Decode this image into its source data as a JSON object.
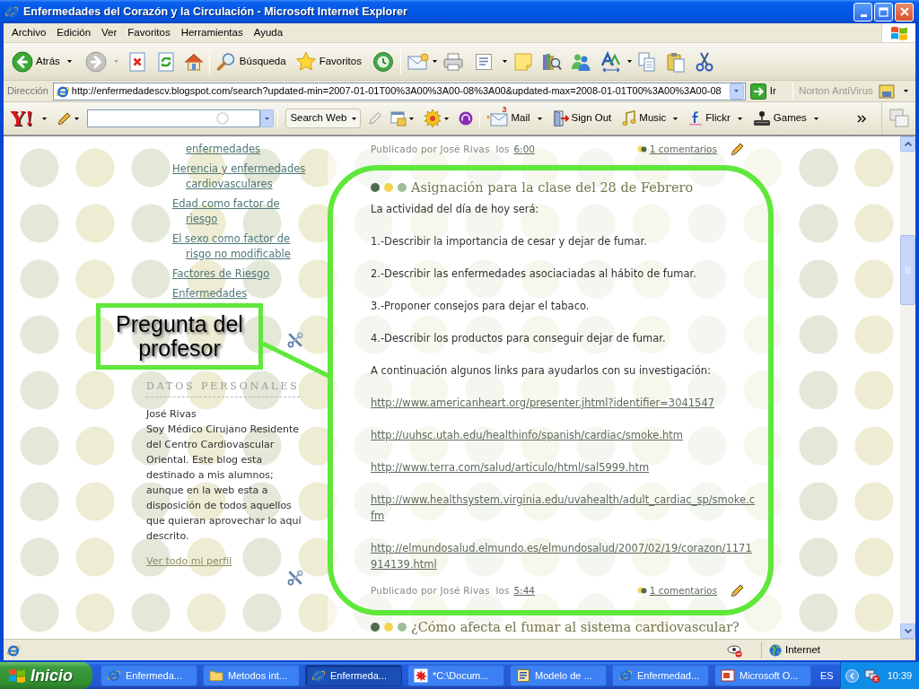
{
  "window": {
    "title": "Enfermedades del Corazón y la Circulación - Microsoft Internet Explorer"
  },
  "menu_bar": {
    "items": [
      "Archivo",
      "Edición",
      "Ver",
      "Favoritos",
      "Herramientas",
      "Ayuda"
    ]
  },
  "toolbar": {
    "back": {
      "label": "Atrás"
    },
    "forward": {
      "disabled": true
    },
    "search": {
      "label": "Búsqueda"
    },
    "favorites": {
      "label": "Favoritos"
    }
  },
  "address_bar": {
    "label": "Dirección",
    "value": "http://enfermedadescv.blogspot.com/search?updated-min=2007-01-01T00%3A00%3A00-08%3A00&updated-max=2008-01-01T00%3A00%3A00-08",
    "go_label": "Ir",
    "norton": {
      "label": "Norton AntiVirus",
      "disabled": true
    }
  },
  "search_toolbar": {
    "logo": "Y!",
    "search_button": "Search Web",
    "items": [
      {
        "kind": "mail",
        "label": "Mail",
        "badge": "3",
        "has_menu": true
      },
      {
        "kind": "sign_out",
        "label": "Sign Out",
        "has_menu": false
      },
      {
        "kind": "music",
        "label": "Music",
        "has_menu": true
      },
      {
        "kind": "flickr",
        "label": "Flickr",
        "has_menu": true
      },
      {
        "kind": "games",
        "label": "Games",
        "has_menu": true
      }
    ]
  },
  "sidebar": {
    "partial_link": "enfermedades",
    "links": [
      "Herencia y enfermedades cardiovasculares",
      "Edad como factor de riesgo",
      "El sexo como factor de risgo no modificable",
      "Factores de Riesgo",
      "Enfermedades"
    ],
    "profile": {
      "heading": "DATOS PERSONALES",
      "name": "José Rivas",
      "about": "Soy Médico Cirujano Residente del Centro Cardiovascular Oriental. Este blog esta destinado a mis alumnos; aunque en la web esta a disposición de todos aquellos que quieran aprovechar lo aquí descrito.",
      "more_link": "Ver todo mi perfil"
    }
  },
  "annotation": {
    "text": "Pregunta del profesor"
  },
  "main": {
    "previous_footer": {
      "byline": "Publicado por José Rivas",
      "time_prefix": "los",
      "time": "6:00",
      "comments": "1 comentarios"
    },
    "post": {
      "dots": [
        {
          "color": "#4d6b4d"
        },
        {
          "color": "#f3d54e"
        },
        {
          "color": "#9fbf9a"
        }
      ],
      "title": "Asignación para la clase del 28 de Febrero",
      "paragraphs": [
        {
          "kind": "text",
          "text": "La actividad del día de hoy será:"
        },
        {
          "kind": "text",
          "text": "1.-Describir la importancia de cesar y dejar de fumar."
        },
        {
          "kind": "text",
          "text": "2.-Describir las enfermedades asociaciadas al hábito de fumar."
        },
        {
          "kind": "text",
          "text": "3.-Proponer consejos para dejar el tabaco."
        },
        {
          "kind": "text",
          "text": "4.-Describir los productos para conseguir dejar de fumar."
        },
        {
          "kind": "text",
          "text": "A continuación algunos links para ayudarlos con su investigación:"
        },
        {
          "kind": "link",
          "text": "http://www.americanheart.org/presenter.jhtml?identifier=3041547"
        },
        {
          "kind": "link",
          "text": "http://uuhsc.utah.edu/healthinfo/spanish/cardiac/smoke.htm"
        },
        {
          "kind": "link",
          "text": "http://www.terra.com/salud/articulo/html/sal5999.htm"
        },
        {
          "kind": "link",
          "text": "http://www.healthsystem.virginia.edu/uvahealth/adult_cardiac_sp/smoke.cfm"
        },
        {
          "kind": "link",
          "text": "http://elmundosalud.elmundo.es/elmundosalud/2007/02/19/corazon/1171914139.html"
        }
      ],
      "footer": {
        "byline": "Publicado por José Rivas",
        "time_prefix": "los",
        "time": "5:44",
        "comments": "1 comentarios"
      }
    },
    "next_post": {
      "dots": [
        {
          "color": "#4d6b4d"
        },
        {
          "color": "#f3d54e"
        },
        {
          "color": "#9fbf9a"
        }
      ],
      "title": "¿Cómo afecta el fumar al sistema cardiovascular?"
    }
  },
  "status_bar": {
    "zone": "Internet"
  },
  "taskbar": {
    "start_label": "Inicio",
    "buttons": [
      {
        "kind": "browser",
        "label": "Enfermeda...",
        "selected": false
      },
      {
        "kind": "folder",
        "label": "Metodos int...",
        "selected": false
      },
      {
        "kind": "browser",
        "label": "Enfermeda...",
        "selected": true
      },
      {
        "kind": "paint",
        "label": "*C:\\Docum...",
        "selected": false
      },
      {
        "kind": "document",
        "label": "Modelo de ...",
        "selected": false
      },
      {
        "kind": "browser",
        "label": "Enfermedad...",
        "selected": false
      },
      {
        "kind": "presentation",
        "label": "Microsoft O...",
        "selected": false
      }
    ],
    "language": "ES",
    "clock": "10:39"
  }
}
